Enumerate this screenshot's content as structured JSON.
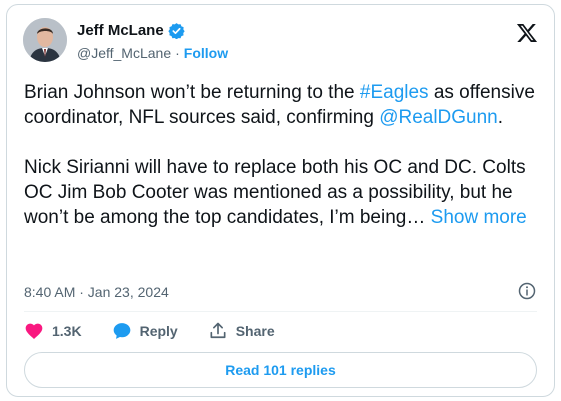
{
  "author": {
    "name": "Jeff McLane",
    "handle": "@Jeff_McLane",
    "separator": "·",
    "follow_label": "Follow",
    "verified": true
  },
  "tweet": {
    "p1_pre": "Brian Johnson won’t be returning to the ",
    "p1_tag": "#Eagles",
    "p1_mid": " as offensive coordinator, NFL sources said, confirming ",
    "p1_mention": "@RealDGunn",
    "p1_post": ".",
    "p2": "Nick Sirianni will have to replace both his OC and DC. Colts OC Jim Bob Cooter was mentioned as a possibility, but he won’t be among the top candidates, I’m being… ",
    "show_more": "Show more",
    "timestamp": "8:40 AM · Jan 23, 2024"
  },
  "actions": {
    "likes": "1.3K",
    "reply_label": "Reply",
    "share_label": "Share"
  },
  "replies_button": "Read 101 replies",
  "colors": {
    "accent": "#1d9bf0",
    "like": "#f91880",
    "text": "#0f1419",
    "muted": "#536471"
  },
  "icons": [
    "verified-badge-icon",
    "x-logo-icon",
    "info-icon",
    "heart-icon",
    "reply-bubble-icon",
    "share-icon"
  ]
}
